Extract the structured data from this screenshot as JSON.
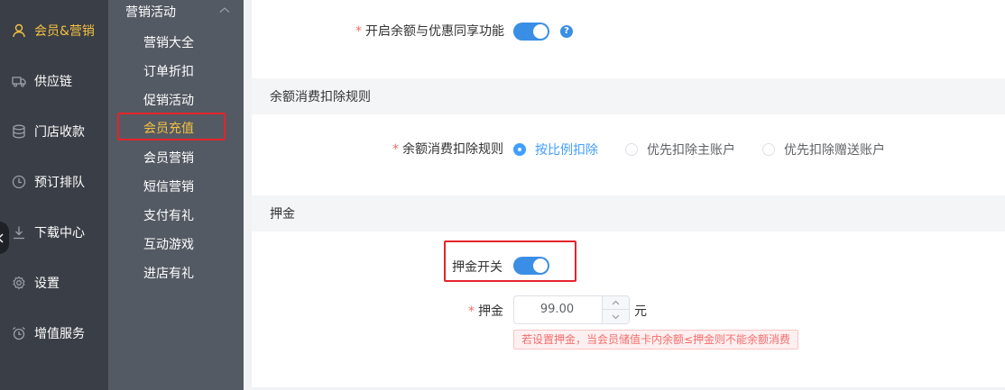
{
  "primary_nav": [
    {
      "label": "会员&营销",
      "icon": "user-icon",
      "active": true
    },
    {
      "label": "供应链",
      "icon": "truck-icon"
    },
    {
      "label": "门店收款",
      "icon": "database-icon"
    },
    {
      "label": "预订排队",
      "icon": "clock-icon"
    },
    {
      "label": "下载中心",
      "icon": "download-icon"
    },
    {
      "label": "设置",
      "icon": "gear-icon"
    },
    {
      "label": "增值服务",
      "icon": "alarm-icon"
    }
  ],
  "secondary_nav": {
    "group_title": "营销活动",
    "items": [
      {
        "label": "营销大全"
      },
      {
        "label": "订单折扣"
      },
      {
        "label": "促销活动"
      },
      {
        "label": "会员充值",
        "active": true
      },
      {
        "label": "会员营销"
      },
      {
        "label": "短信营销"
      },
      {
        "label": "支付有礼"
      },
      {
        "label": "互动游戏"
      },
      {
        "label": "进店有礼"
      }
    ]
  },
  "form": {
    "share_label": "开启余额与优惠同享功能",
    "share_required_mark": "*",
    "share_help_glyph": "?",
    "share_enabled": true,
    "deduct_section_title": "余额消费扣除规则",
    "deduct_label": "余额消费扣除规则",
    "deduct_required_mark": "*",
    "deduct_options": [
      {
        "label": "按比例扣除",
        "selected": true
      },
      {
        "label": "优先扣除主账户",
        "selected": false
      },
      {
        "label": "优先扣除赠送账户",
        "selected": false
      }
    ],
    "deposit_section_title": "押金",
    "deposit_switch_label": "押金开关",
    "deposit_switch_on": true,
    "deposit_label": "押金",
    "deposit_required_mark": "*",
    "deposit_value": "99.00",
    "deposit_unit": "元",
    "deposit_tip": "若设置押金，当会员储值卡内余额≤押金则不能余额消费"
  },
  "colors": {
    "accent": "#3a8ee6",
    "active_nav": "#f5c242",
    "highlight_box": "#e5232b",
    "required": "#f56c6c"
  }
}
